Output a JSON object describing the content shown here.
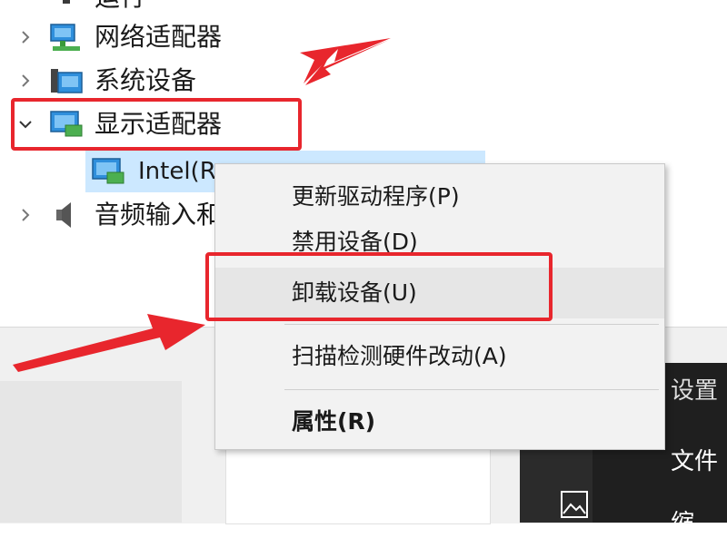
{
  "device_tree": {
    "items": [
      {
        "label": "运行",
        "icon": "adapter-icon",
        "expanded": false
      },
      {
        "label": "网络适配器",
        "icon": "network-adapter-icon",
        "expanded": false
      },
      {
        "label": "系统设备",
        "icon": "system-device-icon",
        "expanded": false
      },
      {
        "label": "显示适配器",
        "icon": "display-adapter-icon",
        "expanded": true
      },
      {
        "label": "音频输入和",
        "icon": "speaker-icon",
        "expanded": false
      }
    ],
    "selected_child": {
      "label": "Intel(R",
      "icon": "display-adapter-icon"
    }
  },
  "context_menu": {
    "items": [
      {
        "label": "更新驱动程序(P)"
      },
      {
        "label": "禁用设备(D)"
      },
      {
        "label": "卸载设备(U)"
      },
      {
        "label": "扫描检测硬件改动(A)"
      },
      {
        "label": "属性(R)"
      }
    ]
  },
  "background_pane": {
    "text_1": "设置",
    "text_2": "文件",
    "text_3": "缩"
  },
  "annotations": {
    "highlight_color": "#e8262d"
  }
}
